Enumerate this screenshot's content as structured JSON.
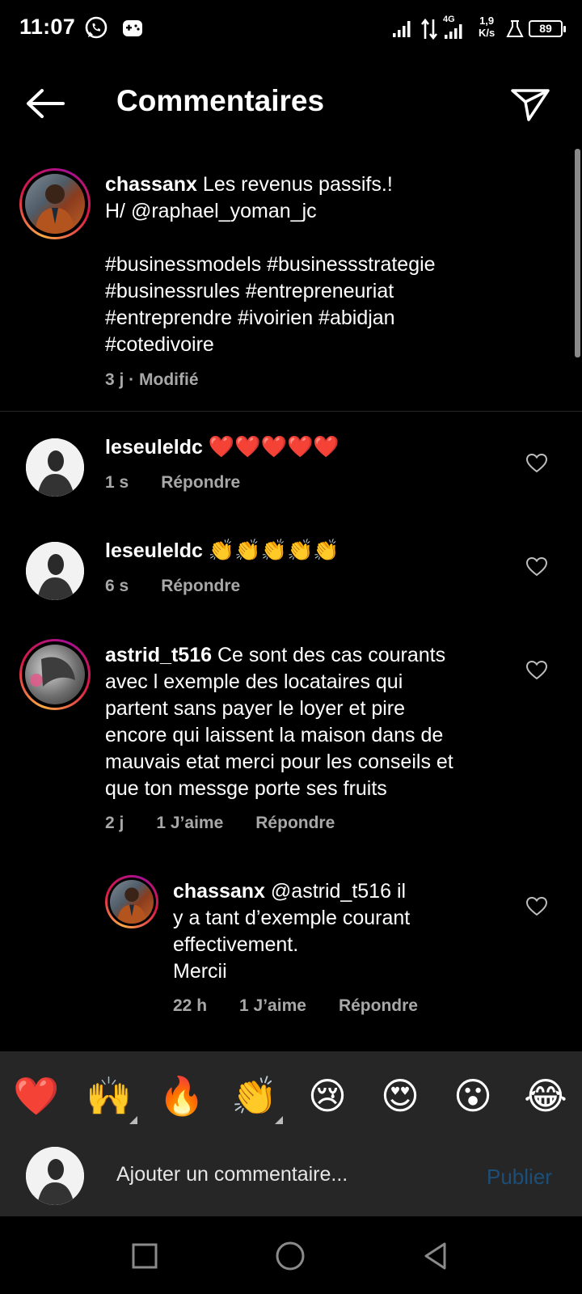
{
  "status_bar": {
    "time": "11:07",
    "network_type": "4G",
    "speed_value": "1,9",
    "speed_unit": "K/s",
    "battery": "89"
  },
  "header": {
    "title": "Commentaires"
  },
  "caption": {
    "username": "chassanx",
    "text_line1": "Les revenus passifs.!",
    "text_line2": "H/ @raphael_yoman_jc",
    "hashtags": [
      "#businessmodels #businessstrategie",
      "#businessrules #entrepreneuriat",
      "#entreprendre #ivoirien #abidjan",
      "#cotedivoire"
    ],
    "meta": "3 j · Modifié"
  },
  "comments": [
    {
      "username": "leseuleldc",
      "text": "❤️❤️❤️❤️❤️",
      "time": "1 s",
      "reply": "Répondre"
    },
    {
      "username": "leseuleldc",
      "text": "👏👏👏👏👏",
      "time": "6 s",
      "reply": "Répondre"
    },
    {
      "username": "astrid_t516",
      "text_lines": [
        "Ce sont des cas courants",
        "avec l exemple des locataires qui",
        "partent sans payer le loyer et pire",
        "encore qui laissent la maison dans de",
        "mauvais  etat merci pour les conseils et",
        "que ton messge porte ses fruits"
      ],
      "time": "2 j",
      "likes": "1 J’aime",
      "reply": "Répondre"
    }
  ],
  "reply": {
    "username": "chassanx",
    "text_lines": [
      "@astrid_t516 il",
      "y a tant d’exemple courant",
      "effectivement.",
      "Mercii"
    ],
    "time": "22 h",
    "likes": "1 J’aime",
    "reply": "Répondre"
  },
  "emoji_bar": [
    "❤️",
    "🙌",
    "🔥",
    "👏",
    "😢",
    "😍",
    "😮",
    "😂"
  ],
  "composer": {
    "placeholder": "Ajouter un commentaire...",
    "publish_label": "Publier"
  },
  "colors": {
    "background": "#000000",
    "muted_text": "#a8a8a8",
    "bar_background": "#262626",
    "publish_disabled": "#1b4f7a",
    "story_ring": [
      "#fbaa47",
      "#d91a46",
      "#a60f93"
    ]
  }
}
